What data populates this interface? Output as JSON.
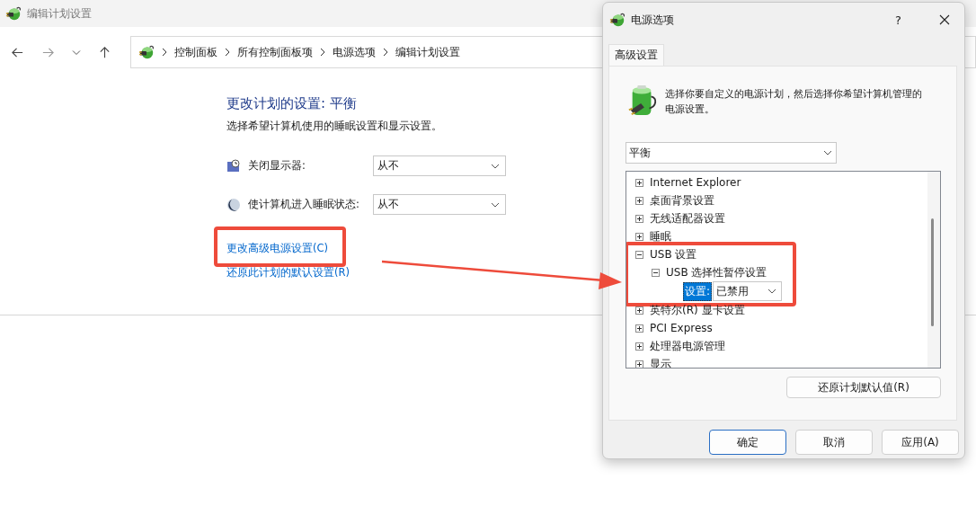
{
  "window": {
    "title": "编辑计划设置"
  },
  "nav": {
    "breadcrumbs": [
      "控制面板",
      "所有控制面板项",
      "电源选项",
      "编辑计划设置"
    ]
  },
  "plan": {
    "heading": "更改计划的设置: 平衡",
    "subtitle": "选择希望计算机使用的睡眠设置和显示设置。",
    "settings": [
      {
        "kind": "display",
        "label": "关闭显示器:",
        "value": "从不"
      },
      {
        "kind": "sleep",
        "label": "使计算机进入睡眠状态:",
        "value": "从不"
      }
    ],
    "links": [
      {
        "text": "更改高级电源设置(C)",
        "highlighted": true
      },
      {
        "text": "还原此计划的默认设置(R)",
        "highlighted": false
      }
    ]
  },
  "dialog": {
    "title": "电源选项",
    "help": "?",
    "tabs": [
      {
        "label": "高级设置",
        "selected": true
      }
    ],
    "description": "选择你要自定义的电源计划，然后选择你希望计算机管理的电源设置。",
    "plan_select": "平衡",
    "tree": [
      {
        "label": "Internet Explorer",
        "expanded": false,
        "highlighted": false
      },
      {
        "label": "桌面背景设置",
        "expanded": false,
        "highlighted": false
      },
      {
        "label": "无线适配器设置",
        "expanded": false,
        "highlighted": false
      },
      {
        "label": "睡眠",
        "expanded": false,
        "highlighted": false
      },
      {
        "label": "USB 设置",
        "expanded": true,
        "highlighted": true,
        "children": [
          {
            "label": "USB 选择性暂停设置",
            "expanded": true,
            "highlighted": false,
            "children": [
              {
                "kind": "setting",
                "label": "设置:",
                "value": "已禁用",
                "selected": true
              }
            ]
          }
        ]
      },
      {
        "label": "英特尔(R) 显卡设置",
        "expanded": false,
        "highlighted": false
      },
      {
        "label": "PCI Express",
        "expanded": false,
        "highlighted": false
      },
      {
        "label": "处理器电源管理",
        "expanded": false,
        "highlighted": false
      },
      {
        "label": "显示",
        "expanded": false,
        "highlighted": false
      }
    ],
    "restore_button": "还原计划默认值(R)",
    "buttons": [
      {
        "label": "确定",
        "default": true
      },
      {
        "label": "取消",
        "default": false
      },
      {
        "label": "应用(A)",
        "default": false
      }
    ]
  }
}
